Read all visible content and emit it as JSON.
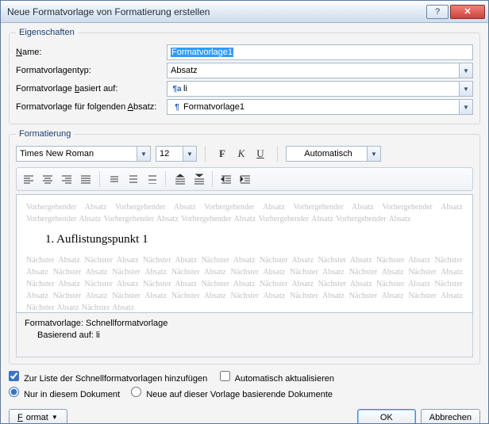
{
  "window": {
    "title": "Neue Formatvorlage von Formatierung erstellen"
  },
  "groups": {
    "properties": "Eigenschaften",
    "formatting": "Formatierung"
  },
  "props": {
    "name_label": "Name:",
    "name_value": "Formatvorlage1",
    "type_label": "Formatvorlagentyp:",
    "type_value": "Absatz",
    "based_label": "Formatvorlage basiert auf:",
    "based_icon": "¶a",
    "based_value": "li",
    "next_label": "Formatvorlage für folgenden Absatz:",
    "next_icon": "¶",
    "next_value": "Formatvorlage1"
  },
  "fmt": {
    "font": "Times New Roman",
    "size": "12",
    "bold": "F",
    "italic": "K",
    "underline": "U",
    "color": "Automatisch"
  },
  "preview": {
    "ghost_before": "Vorhergehender Absatz Vorhergehender Absatz Vorhergehender Absatz Vorhergehender Absatz Vorhergehender Absatz Vorhergehender Absatz Vorhergehender Absatz Vorhergehender Absatz Vorhergehender Absatz Vorhergehender Absatz",
    "sample": "1.   Auflistungspunkt 1",
    "ghost_after": "Nächster Absatz Nächster Absatz Nächster Absatz Nächster Absatz Nächster Absatz Nächster Absatz Nächster Absatz Nächster Absatz Nächster Absatz Nächster Absatz Nächster Absatz Nächster Absatz Nächster Absatz Nächster Absatz Nächster Absatz Nächster Absatz Nächster Absatz Nächster Absatz Nächster Absatz Nächster Absatz Nächster Absatz Nächster Absatz Nächster Absatz Nächster Absatz Nächster Absatz Nächster Absatz Nächster Absatz Nächster Absatz Nächster Absatz Nächster Absatz Nächster Absatz Nächster Absatz"
  },
  "desc": {
    "line1": "Formatvorlage: Schnellformatvorlage",
    "line2": "Basierend auf: li"
  },
  "options": {
    "add_quick": "Zur Liste der Schnellformatvorlagen hinzufügen",
    "auto_update": "Automatisch aktualisieren",
    "only_doc": "Nur in diesem Dokument",
    "new_based": "Neue auf dieser Vorlage basierende Dokumente"
  },
  "buttons": {
    "format": "Format",
    "ok": "OK",
    "cancel": "Abbrechen"
  }
}
